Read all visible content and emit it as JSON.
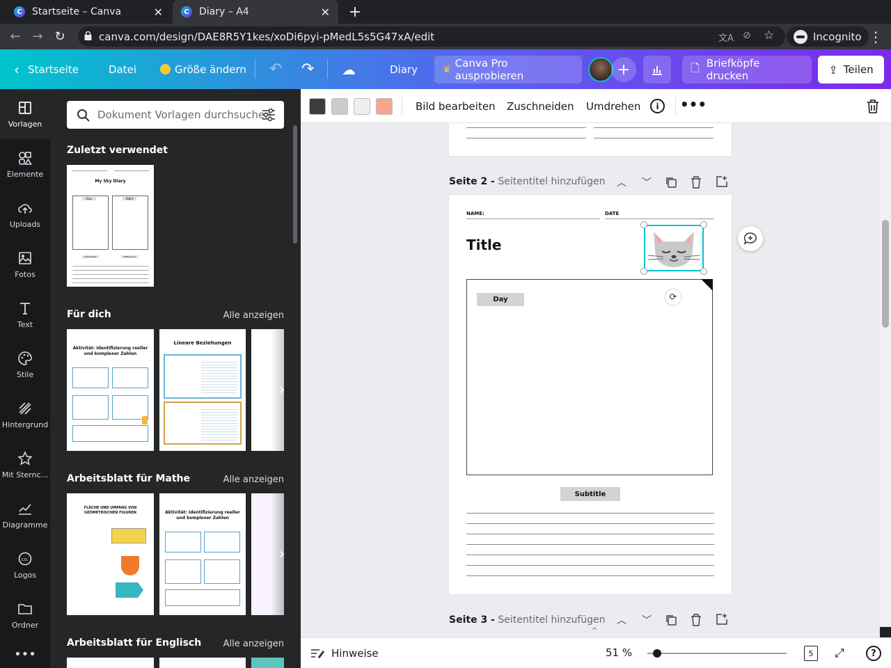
{
  "browser": {
    "tabs": [
      {
        "title": "Startseite – Canva",
        "active": false
      },
      {
        "title": "Diary – A4",
        "active": true
      }
    ],
    "url": "canva.com/design/DAE8R5Y1kes/xoDi6pyi-pMedL5s5G47xA/edit",
    "incognito_label": "Incognito"
  },
  "header": {
    "back_label": "Startseite",
    "file_label": "Datei",
    "resize_label": "Größe ändern",
    "doc_title": "Diary",
    "pro_label": "Canva Pro ausprobieren",
    "print_label": "Briefköpfe drucken",
    "share_label": "Teilen"
  },
  "rail": [
    {
      "label": "Vorlagen",
      "icon": "templates-icon"
    },
    {
      "label": "Elemente",
      "icon": "elements-icon"
    },
    {
      "label": "Uploads",
      "icon": "upload-cloud-icon"
    },
    {
      "label": "Fotos",
      "icon": "photo-icon"
    },
    {
      "label": "Text",
      "icon": "text-icon"
    },
    {
      "label": "Stile",
      "icon": "palette-icon"
    },
    {
      "label": "Hintergrund",
      "icon": "background-icon"
    },
    {
      "label": "Mit Sternc...",
      "icon": "star-icon"
    },
    {
      "label": "Diagramme",
      "icon": "chart-icon"
    },
    {
      "label": "Logos",
      "icon": "logo-icon"
    },
    {
      "label": "Ordner",
      "icon": "folder-icon"
    }
  ],
  "panel": {
    "search_placeholder": "Dokument Vorlagen durchsuchen",
    "recent_title": "Zuletzt verwendet",
    "foryou_title": "Für dich",
    "math_title": "Arbeitsblatt für Mathe",
    "english_title": "Arbeitsblatt für Englisch",
    "see_all": "Alle anzeigen",
    "recent_thumb": {
      "title": "My Sky Diary",
      "left_label": "Day",
      "right_label": "Night",
      "bottom_left": "Similarities",
      "bottom_right": "Differences"
    },
    "foryou_thumb1": {
      "title": "Aktivität: Identifizierung reeller und komplexer Zahlen"
    },
    "foryou_thumb2": {
      "title": "Lineare Beziehungen"
    },
    "math_thumb1": {
      "title": "FLÄCHE UND UMFANG VON GEOMETRISCHEN FIGUREN"
    },
    "math_thumb2": {
      "title": "Aktivität: Identifizierung reeller und komplexer Zahlen"
    }
  },
  "toolbar": {
    "swatches": [
      "#3c3c3c",
      "#cccccc",
      "#eeeeee",
      "#f9a48c"
    ],
    "edit_image": "Bild bearbeiten",
    "crop": "Zuschneiden",
    "flip": "Umdrehen"
  },
  "canvas": {
    "page2_label": "Seite 2 -",
    "page2_placeholder": "Seitentitel hinzufügen",
    "page3_label": "Seite 3 -",
    "page3_placeholder": "Seitentitel hinzufügen",
    "name_label": "NAME:",
    "date_label": "DATE",
    "title": "Title",
    "day_label": "Day",
    "subtitle": "Subtitle"
  },
  "bottom": {
    "notes_label": "Hinweise",
    "zoom": "51 %",
    "zoom_fraction": 0.07,
    "page_count": "5"
  },
  "colors": {
    "accent": "#00c4cc",
    "brand_purple": "#7d2ae8",
    "selection": "#00c4cc"
  }
}
